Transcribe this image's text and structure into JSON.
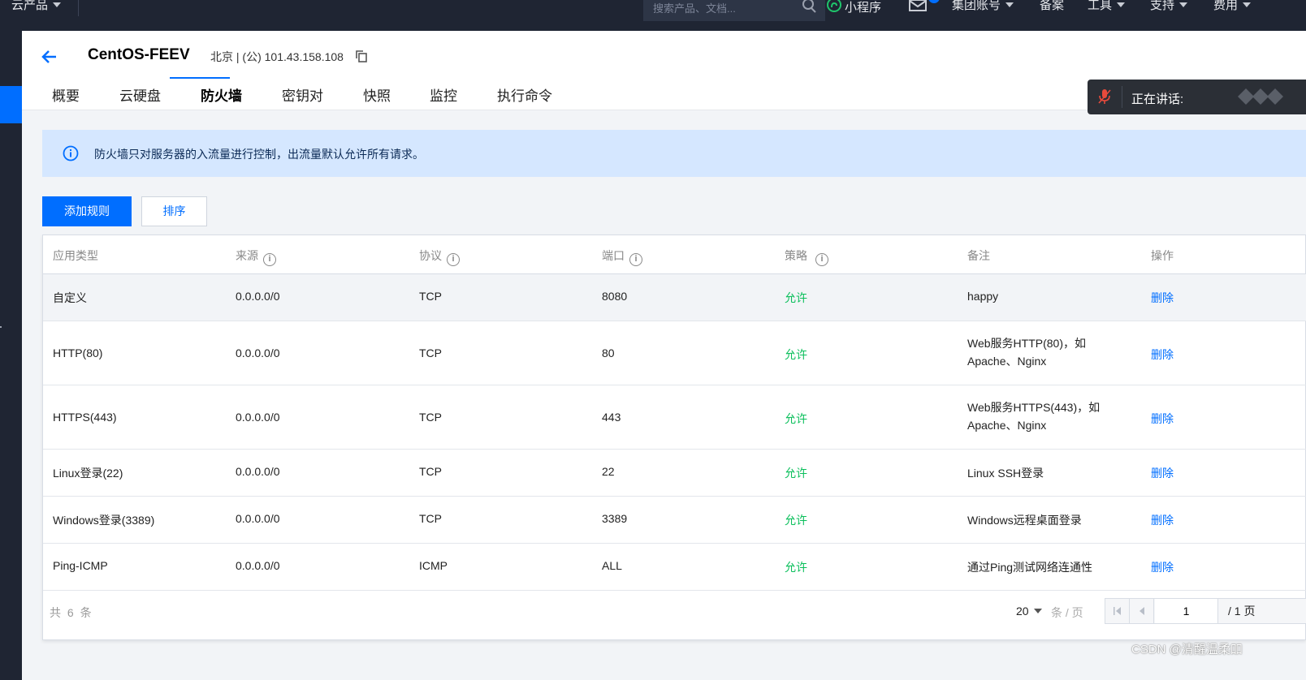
{
  "topnav": {
    "products": "云产品",
    "search_placeholder": "搜索产品、文档...",
    "miniprogram": "小程序",
    "account": "集团账号",
    "beian": "备案",
    "tools": "工具",
    "support": "支持",
    "billing": "费用"
  },
  "header": {
    "title": "CentOS-FEEV",
    "subtitle": "北京 | (公) 101.43.158.108",
    "tabs": [
      "概要",
      "云硬盘",
      "防火墙",
      "密钥对",
      "快照",
      "监控",
      "执行命令"
    ],
    "active_tab": "防火墙"
  },
  "speaking": {
    "label": "正在讲话:"
  },
  "alert": {
    "text": "防火墙只对服务器的入流量进行控制，出流量默认允许所有请求。"
  },
  "buttons": {
    "add_rule": "添加规则",
    "sort": "排序"
  },
  "table": {
    "columns": [
      "应用类型",
      "来源",
      "协议",
      "端口",
      "策略",
      "备注",
      "操作"
    ],
    "rows": [
      {
        "app": "自定义",
        "source": "0.0.0.0/0",
        "protocol": "TCP",
        "port": "8080",
        "policy": "允许",
        "note": "happy",
        "action": "删除"
      },
      {
        "app": "HTTP(80)",
        "source": "0.0.0.0/0",
        "protocol": "TCP",
        "port": "80",
        "policy": "允许",
        "note": "Web服务HTTP(80)，如Apache、Nginx",
        "action": "删除"
      },
      {
        "app": "HTTPS(443)",
        "source": "0.0.0.0/0",
        "protocol": "TCP",
        "port": "443",
        "policy": "允许",
        "note": "Web服务HTTPS(443)，如Apache、Nginx",
        "action": "删除"
      },
      {
        "app": "Linux登录(22)",
        "source": "0.0.0.0/0",
        "protocol": "TCP",
        "port": "22",
        "policy": "允许",
        "note": "Linux SSH登录",
        "action": "删除"
      },
      {
        "app": "Windows登录(3389)",
        "source": "0.0.0.0/0",
        "protocol": "TCP",
        "port": "3389",
        "policy": "允许",
        "note": "Windows远程桌面登录",
        "action": "删除"
      },
      {
        "app": "Ping-ICMP",
        "source": "0.0.0.0/0",
        "protocol": "ICMP",
        "port": "ALL",
        "policy": "允许",
        "note": "通过Ping测试网络连通性",
        "action": "删除"
      }
    ]
  },
  "footer": {
    "total": "共 6 条",
    "page_size": "20",
    "page_size_unit": "条 / 页",
    "current_page": "1",
    "total_pages": "/ 1 页"
  },
  "watermark": "CSDN @清醒温柔吅",
  "colors": {
    "primary": "#006eff",
    "allow": "#0abf5b",
    "nav_bg": "#1f2533",
    "alert_bg": "#d5e7ff"
  }
}
